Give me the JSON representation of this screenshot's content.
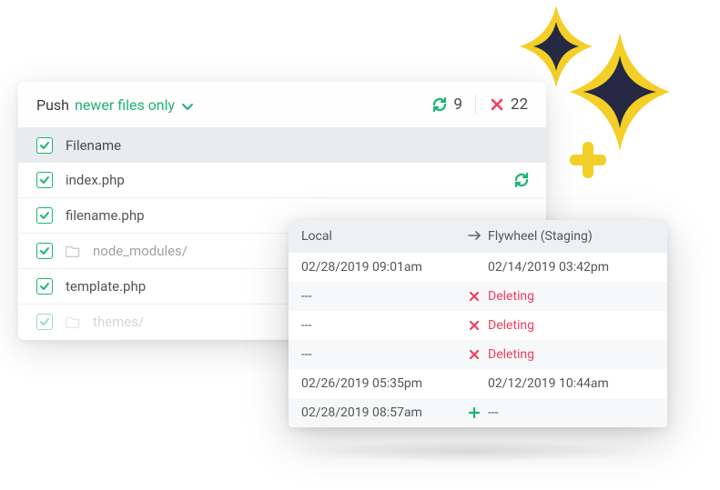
{
  "colors": {
    "green": "#1bb571",
    "red": "#ef3e5e",
    "sparkle": "#f3cf27",
    "sparkle_dark": "#242843"
  },
  "header": {
    "push_label": "Push",
    "filter_label": "newer files only",
    "sync_count": "9",
    "delete_count": "22"
  },
  "column_header": "Filename",
  "rows": [
    {
      "label": "index.php",
      "is_folder": false,
      "show_sync": true
    },
    {
      "label": "filename.php",
      "is_folder": false,
      "show_sync": false
    },
    {
      "label": "node_modules/",
      "is_folder": true,
      "show_sync": false
    },
    {
      "label": "template.php",
      "is_folder": false,
      "show_sync": false
    },
    {
      "label": "themes/",
      "is_folder": true,
      "show_sync": false,
      "faded": true
    }
  ],
  "popup": {
    "local_label": "Local",
    "remote_label": "Flywheel (Staging)",
    "rows": [
      {
        "local": "02/28/2019  09:01am",
        "icon": "",
        "remote": "02/14/2019  03:42pm",
        "status": ""
      },
      {
        "local": "---",
        "icon": "x",
        "remote": "Deleting",
        "status": "del"
      },
      {
        "local": "---",
        "icon": "x",
        "remote": "Deleting",
        "status": "del"
      },
      {
        "local": "---",
        "icon": "x",
        "remote": "Deleting",
        "status": "del"
      },
      {
        "local": "02/26/2019  05:35pm",
        "icon": "",
        "remote": "02/12/2019  10:44am",
        "status": ""
      },
      {
        "local": "02/28/2019  08:57am",
        "icon": "plus",
        "remote": "---",
        "status": ""
      }
    ]
  }
}
